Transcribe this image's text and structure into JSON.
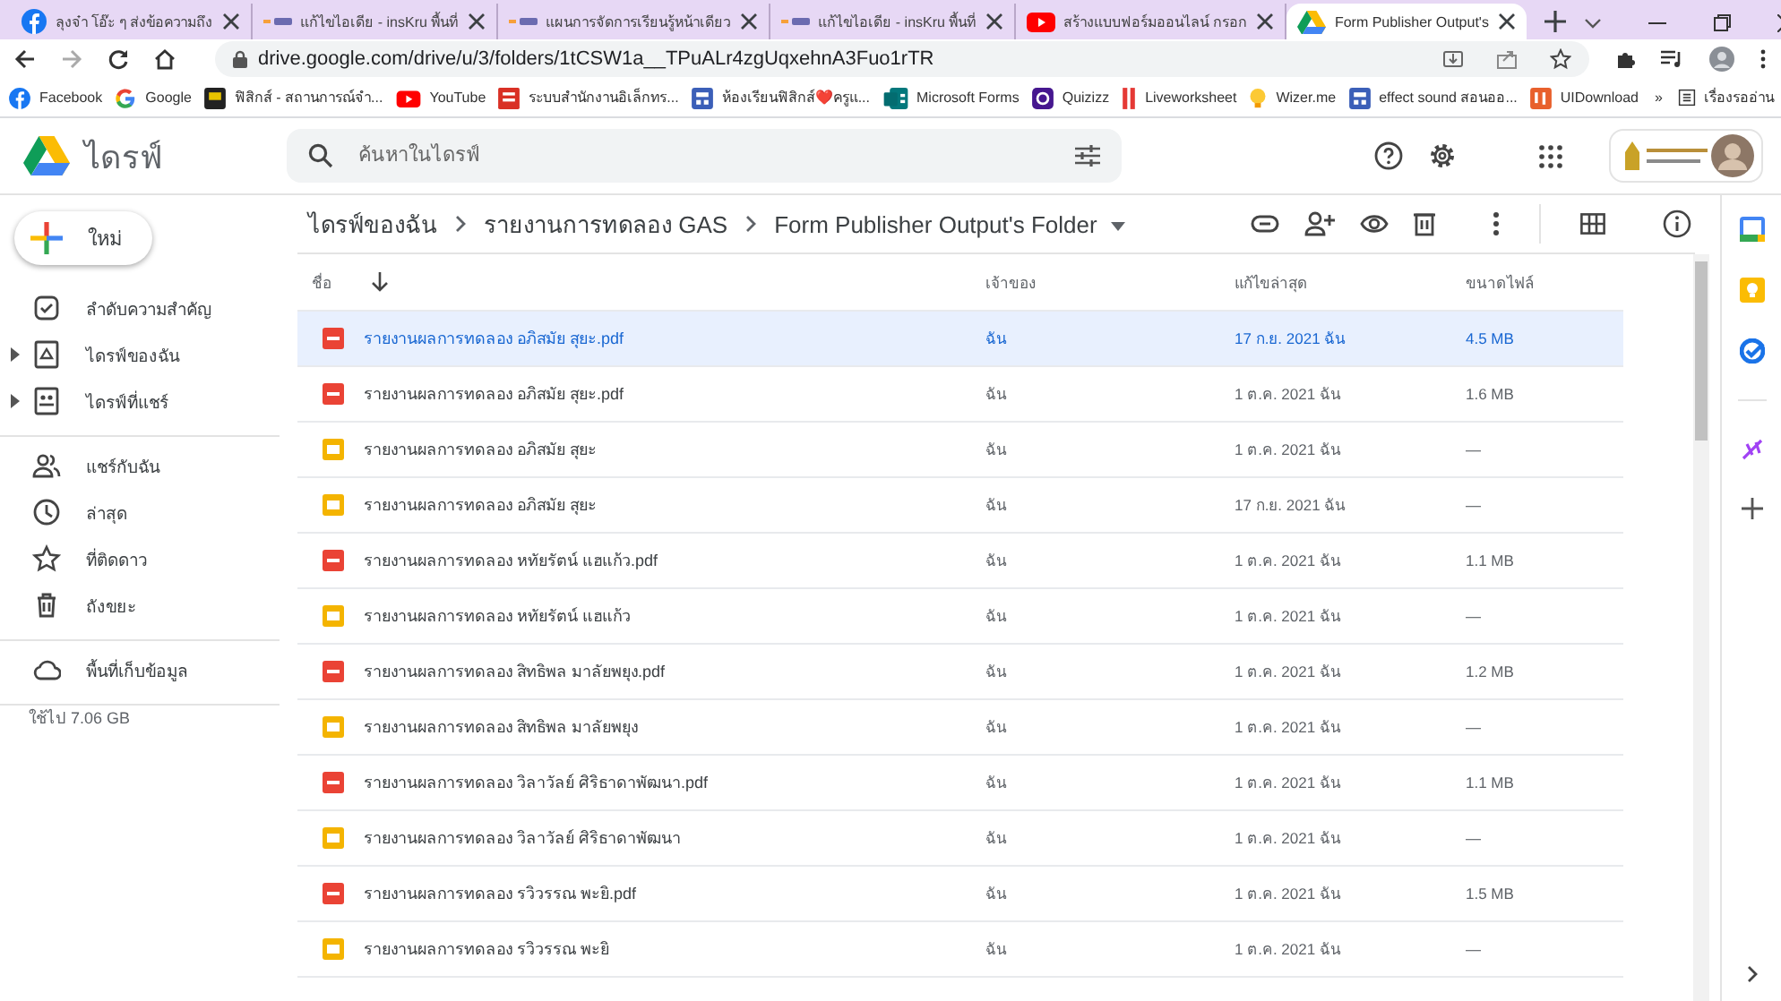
{
  "browser": {
    "tabs": [
      {
        "title": "ลุงจ๋า โอ๊ะ ๆ ส่งข้อความถึง",
        "selected": false
      },
      {
        "title": "แก้ไขไอเดีย - insKru พื้นที่",
        "selected": false
      },
      {
        "title": "แผนการจัดการเรียนรู้หน้าเดียว",
        "selected": false
      },
      {
        "title": "แก้ไขไอเดีย - insKru พื้นที่",
        "selected": false
      },
      {
        "title": "สร้างแบบฟอร์มออนไลน์ กรอก",
        "selected": false
      },
      {
        "title": "Form Publisher Output's",
        "selected": true
      }
    ],
    "address": "drive.google.com/drive/u/3/folders/1tCSW1a__TPuALr4zgUqxehnA3Fuo1rTR",
    "bookmarks": [
      "Facebook",
      "Google",
      "ฟิสิกส์ - สถานการณ์จำ...",
      "YouTube",
      "ระบบสำนักงานอิเล็กทร...",
      "ห้องเรียนฟิสิกส์❤️ครูแ...",
      "Microsoft Forms",
      "Quizizz",
      "Liveworksheet",
      "Wizer.me",
      "effect sound สอนออ...",
      "UIDownload"
    ],
    "more": "»",
    "reading_list": "เรื่องรออ่าน"
  },
  "drive": {
    "title": "ไดรฟ์",
    "search": {
      "placeholder": "ค้นหาในไดรฟ์"
    }
  },
  "sidebar": {
    "new_button": "ใหม่",
    "sections": [
      [
        {
          "label": "ลำดับความสำคัญ",
          "expandable": false
        },
        {
          "label": "ไดรฟ์ของฉัน",
          "expandable": true
        },
        {
          "label": "ไดรฟ์ที่แชร์",
          "expandable": true
        }
      ],
      [
        {
          "label": "แชร์กับฉัน",
          "expandable": false
        },
        {
          "label": "ล่าสุด",
          "expandable": false
        },
        {
          "label": "ที่ติดดาว",
          "expandable": false
        },
        {
          "label": "ถังขยะ",
          "expandable": false
        }
      ],
      [
        {
          "label": "พื้นที่เก็บข้อมูล",
          "expandable": false
        }
      ]
    ],
    "storage_used": "ใช้ไป 7.06 GB"
  },
  "breadcrumb": [
    "ไดรฟ์ของฉัน",
    "รายงานการทดลอง GAS",
    "Form Publisher Output's Folder"
  ],
  "table": {
    "columns": [
      "ชื่อ",
      "เจ้าของ",
      "แก้ไขล่าสุด",
      "ขนาดไฟล์"
    ],
    "rows": [
      {
        "name": "รายงานผลการทดลอง อภิสมัย สุยะ.pdf",
        "kind": "pdf",
        "owner": "ฉัน",
        "modified": "17 ก.ย. 2021 ฉัน",
        "size": "4.5 MB",
        "selected": true
      },
      {
        "name": "รายงานผลการทดลอง อภิสมัย สุยะ.pdf",
        "kind": "pdf",
        "owner": "ฉัน",
        "modified": "1 ต.ค. 2021 ฉัน",
        "size": "1.6 MB",
        "selected": false
      },
      {
        "name": "รายงานผลการทดลอง อภิสมัย สุยะ",
        "kind": "slides",
        "owner": "ฉัน",
        "modified": "1 ต.ค. 2021 ฉัน",
        "size": "—",
        "selected": false
      },
      {
        "name": "รายงานผลการทดลอง อภิสมัย สุยะ",
        "kind": "slides",
        "owner": "ฉัน",
        "modified": "17 ก.ย. 2021 ฉัน",
        "size": "—",
        "selected": false
      },
      {
        "name": "รายงานผลการทดลอง หทัยรัตน์ แฮแก้ว.pdf",
        "kind": "pdf",
        "owner": "ฉัน",
        "modified": "1 ต.ค. 2021 ฉัน",
        "size": "1.1 MB",
        "selected": false
      },
      {
        "name": "รายงานผลการทดลอง หทัยรัตน์ แฮแก้ว",
        "kind": "slides",
        "owner": "ฉัน",
        "modified": "1 ต.ค. 2021 ฉัน",
        "size": "—",
        "selected": false
      },
      {
        "name": "รายงานผลการทดลอง สิทธิพล มาลัยพยุง.pdf",
        "kind": "pdf",
        "owner": "ฉัน",
        "modified": "1 ต.ค. 2021 ฉัน",
        "size": "1.2 MB",
        "selected": false
      },
      {
        "name": "รายงานผลการทดลอง สิทธิพล มาลัยพยุง",
        "kind": "slides",
        "owner": "ฉัน",
        "modified": "1 ต.ค. 2021 ฉัน",
        "size": "—",
        "selected": false
      },
      {
        "name": "รายงานผลการทดลอง วิลาวัลย์ ศิริธาดาพัฒนา.pdf",
        "kind": "pdf",
        "owner": "ฉัน",
        "modified": "1 ต.ค. 2021 ฉัน",
        "size": "1.1 MB",
        "selected": false
      },
      {
        "name": "รายงานผลการทดลอง วิลาวัลย์ ศิริธาดาพัฒนา",
        "kind": "slides",
        "owner": "ฉัน",
        "modified": "1 ต.ค. 2021 ฉัน",
        "size": "—",
        "selected": false
      },
      {
        "name": "รายงานผลการทดลอง รวิวรรณ พะยิ.pdf",
        "kind": "pdf",
        "owner": "ฉัน",
        "modified": "1 ต.ค. 2021 ฉัน",
        "size": "1.5 MB",
        "selected": false
      },
      {
        "name": "รายงานผลการทดลอง รวิวรรณ พะยิ",
        "kind": "slides",
        "owner": "ฉัน",
        "modified": "1 ต.ค. 2021 ฉัน",
        "size": "—",
        "selected": false
      }
    ]
  }
}
